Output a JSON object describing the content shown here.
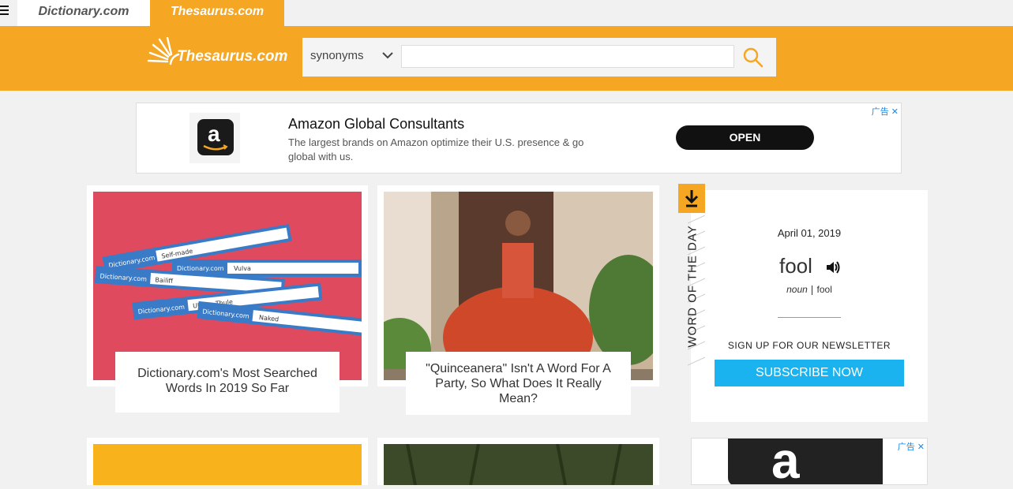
{
  "topnav": {
    "tabs": [
      {
        "label": "Dictionary.com"
      },
      {
        "label": "Thesaurus.com"
      }
    ]
  },
  "header": {
    "logo_text": "Thesaurus.com",
    "search": {
      "mode": "synonyms",
      "placeholder": ""
    }
  },
  "ad": {
    "title": "Amazon Global Consultants",
    "description": "The largest brands on Amazon optimize their U.S. presence & go global with us.",
    "cta": "OPEN",
    "adchoice": "广告"
  },
  "cards": [
    {
      "caption": "Dictionary.com's Most Searched Words In 2019 So Far",
      "search_terms": [
        "Self-made",
        "Vulva",
        "Bailiff",
        "Ultima Thule",
        "Naked"
      ],
      "brand": "Dictionary.com"
    },
    {
      "caption": "\"Quinceanera\" Isn't A Word For A Party, So What Does It Really Mean?"
    }
  ],
  "wotd": {
    "label": "WORD OF THE DAY",
    "date": "April 01, 2019",
    "word": "fool",
    "pos": "noun",
    "pron": "fool",
    "newsletter": "SIGN UP FOR OUR NEWSLETTER",
    "subscribe": "SUBSCRIBE NOW"
  },
  "ad2": {
    "adchoice": "广告"
  },
  "colors": {
    "brand_orange": "#f5a623",
    "subscribe_blue": "#1ab3f0",
    "card_red": "#e04a5f"
  }
}
